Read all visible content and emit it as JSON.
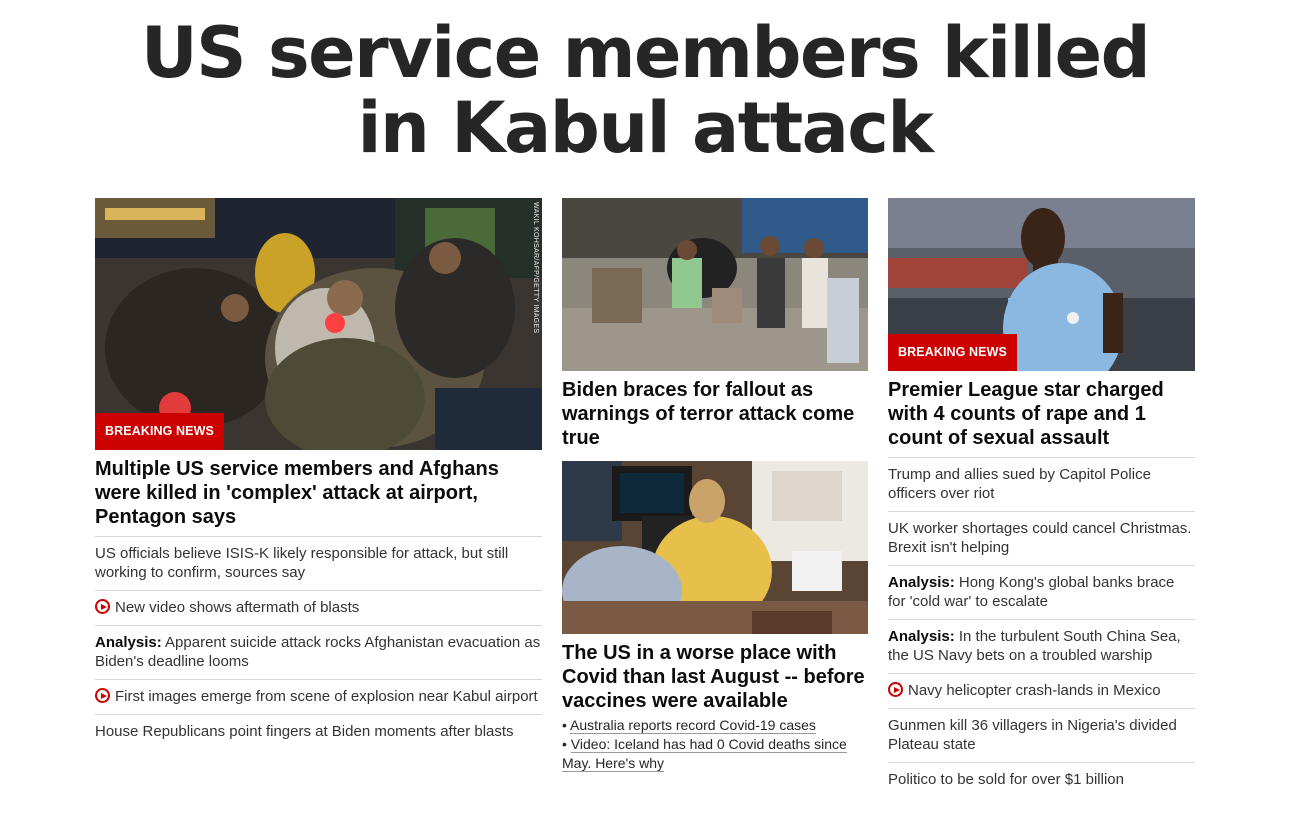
{
  "headline": "US service members killed in Kabul attack",
  "col1": {
    "image_alt": "Injured people being carried at Kabul airport at night",
    "image_credit": "WAKIL KOHSAR/AFP/GETTY IMAGES",
    "badge": "BREAKING NEWS",
    "title": "Multiple US service members and Afghans were killed in 'complex' attack at airport, Pentagon says",
    "items": [
      {
        "text": "US officials believe ISIS-K likely responsible for attack, but still working to confirm, sources say"
      },
      {
        "video": true,
        "text": "New video shows aftermath of blasts"
      },
      {
        "prefix": "Analysis:",
        "text": " Apparent suicide attack rocks Afghanistan evacuation as Biden's deadline looms"
      },
      {
        "video": true,
        "text": "First images emerge from scene of explosion near Kabul airport"
      },
      {
        "text": "House Republicans point fingers at Biden moments after blasts"
      }
    ]
  },
  "col2": {
    "card1_title": "Biden braces for fallout as warnings of terror attack come true",
    "card2_title": "The US in a worse place with Covid than last August -- before vaccines were available",
    "card2_links": [
      "Australia reports record Covid-19 cases",
      "Video: Iceland has had 0 Covid deaths since May. Here's why"
    ],
    "bullet": "•"
  },
  "col3": {
    "badge": "BREAKING NEWS",
    "title": "Premier League star charged with 4 counts of rape and 1 count of sexual assault",
    "items": [
      {
        "text": "Trump and allies sued by Capitol Police officers over riot"
      },
      {
        "text": "UK worker shortages could cancel Christmas. Brexit isn't helping"
      },
      {
        "prefix": "Analysis:",
        "text": " Hong Kong's global banks brace for 'cold war' to escalate"
      },
      {
        "prefix": "Analysis:",
        "text": " In the turbulent South China Sea, the US Navy bets on a troubled warship"
      },
      {
        "video": true,
        "text": "Navy helicopter crash-lands in Mexico"
      },
      {
        "text": "Gunmen kill 36 villagers in Nigeria's divided Plateau state"
      },
      {
        "text": "Politico to be sold for over $1 billion"
      }
    ]
  },
  "colors": {
    "breaking": "#cc0000",
    "text": "#0c0c0c",
    "divider": "#d8d8d8"
  }
}
